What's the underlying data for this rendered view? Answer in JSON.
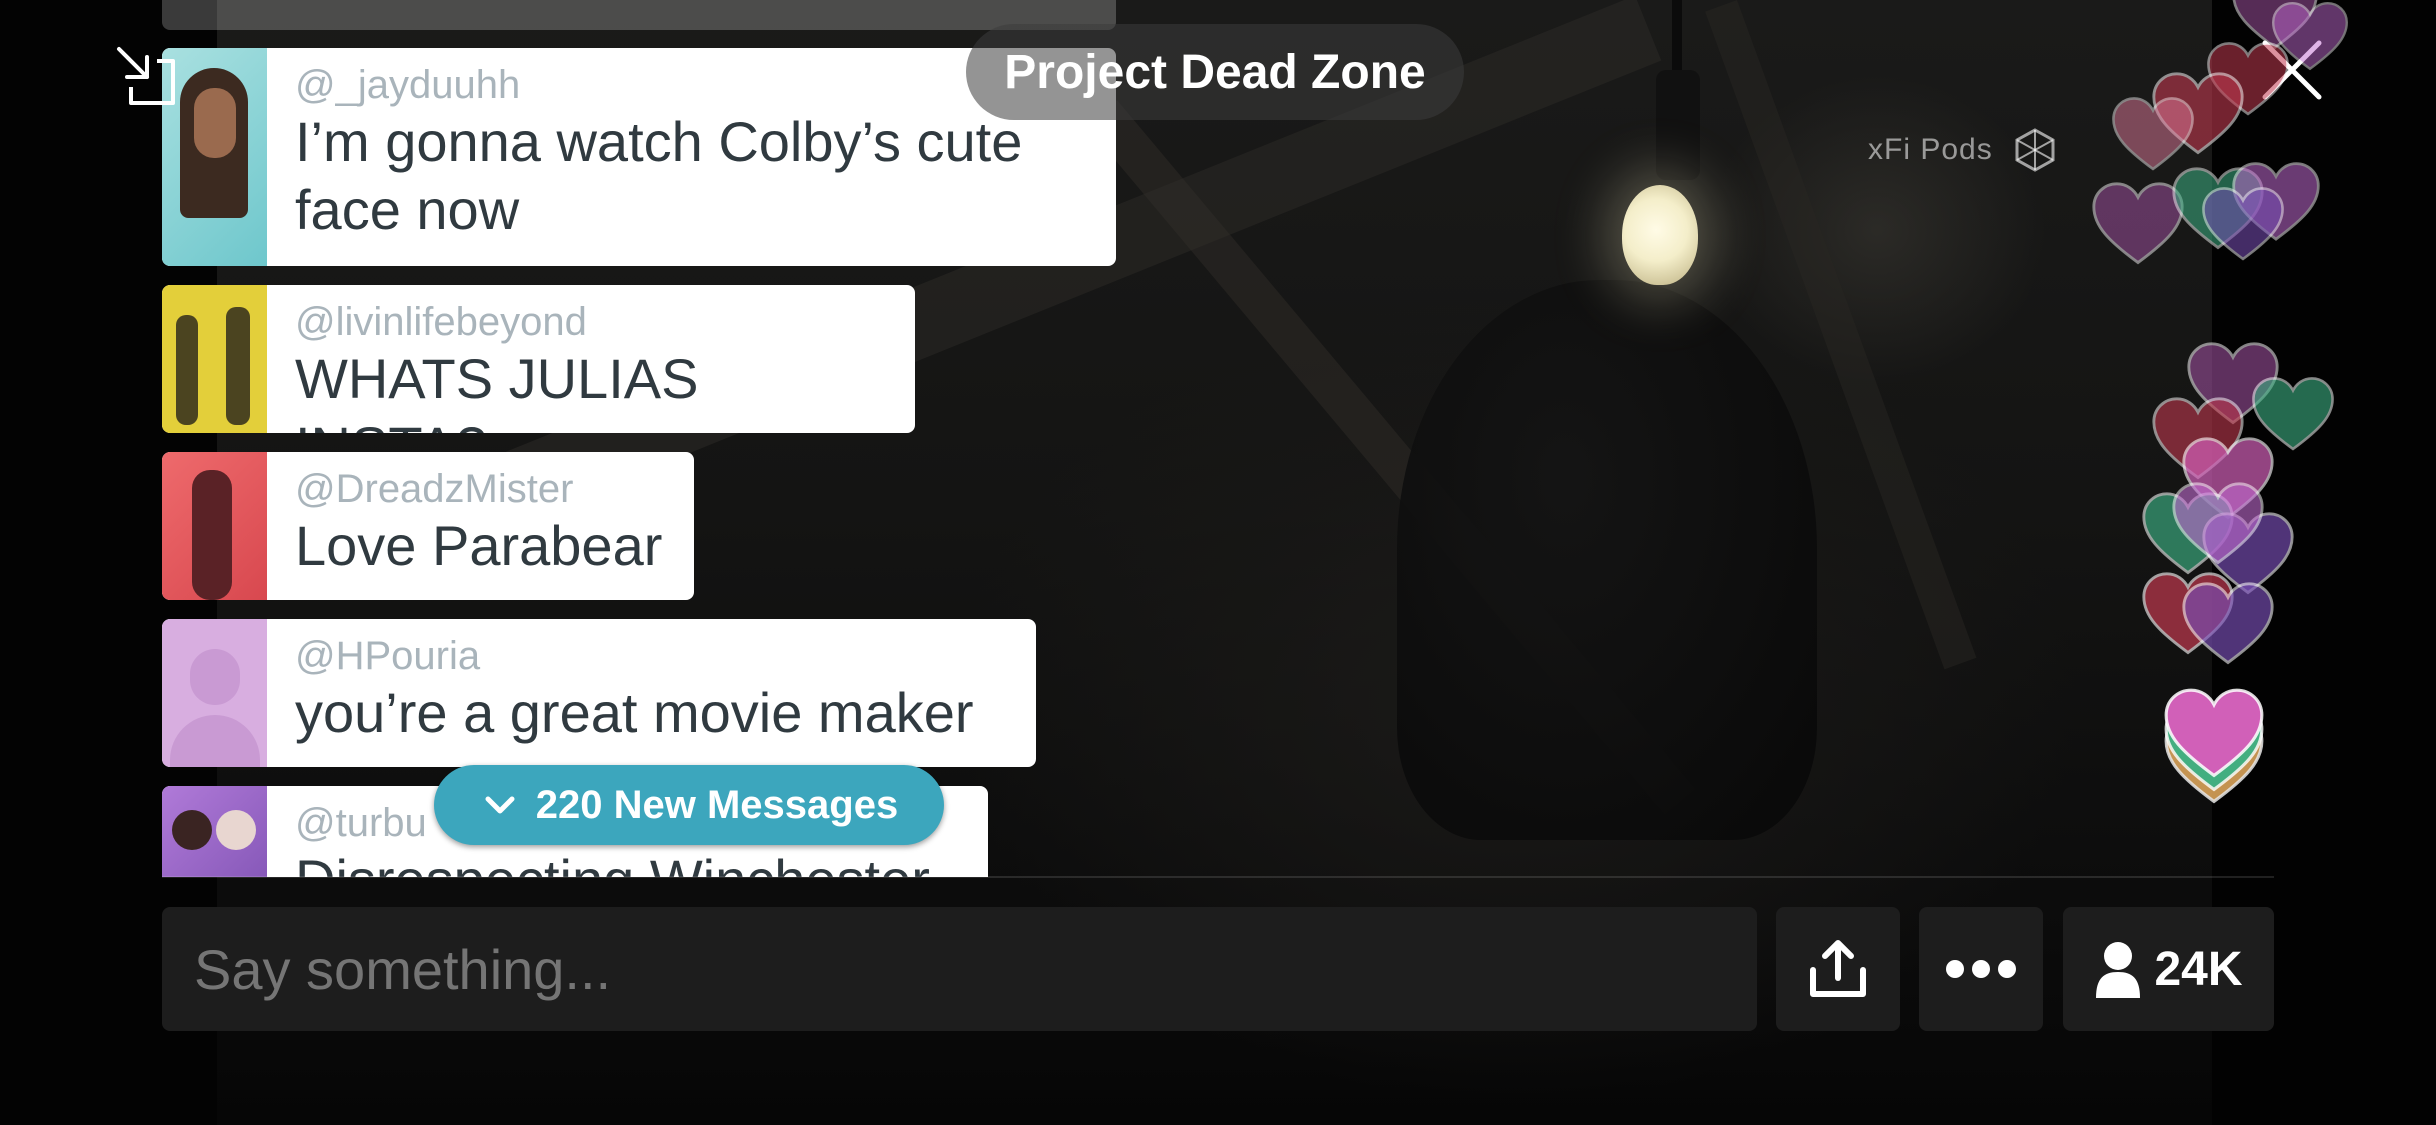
{
  "stream": {
    "title": "Project Dead Zone",
    "watermark": "xFi Pods"
  },
  "chat": {
    "messages": [
      {
        "user": "@_jayduuhh",
        "text_lines": [
          "I’m gonna watch Colby’s cute",
          "face now"
        ],
        "avatar_color": "#8fd3d6"
      },
      {
        "user": "@livinlifebeyond",
        "text_lines": [
          "WHATS JULIAS INSTA?"
        ],
        "avatar_color": "#e3cf3a"
      },
      {
        "user": "@DreadzMister",
        "text_lines": [
          "Love Parabear"
        ],
        "avatar_color": "#e2575b"
      },
      {
        "user": "@HPouria",
        "text_lines": [
          "you’re a great movie maker"
        ],
        "avatar_color": "#d6a6de"
      },
      {
        "user": "@turbu",
        "text_lines": [
          "Disrespecting Winchester"
        ],
        "avatar_color": "#9a6bc2"
      }
    ],
    "new_messages_label": "220 New Messages"
  },
  "composer": {
    "placeholder": "Say something..."
  },
  "viewers": {
    "count": "24K"
  },
  "icons": {
    "minimize": "minimize-icon",
    "close": "close-icon",
    "share": "share-icon",
    "more": "more-icon",
    "viewers": "person-icon",
    "chevron": "chevron-down-icon",
    "watermark_logo": "cube-logo-icon"
  },
  "colors": {
    "accent": "#3ca6bd",
    "hearts": [
      "#9b4f9c",
      "#c06bd0",
      "#3db083",
      "#c0394f",
      "#d160b8",
      "#7a4fb8",
      "#e07a9a",
      "#d9a35a"
    ]
  }
}
